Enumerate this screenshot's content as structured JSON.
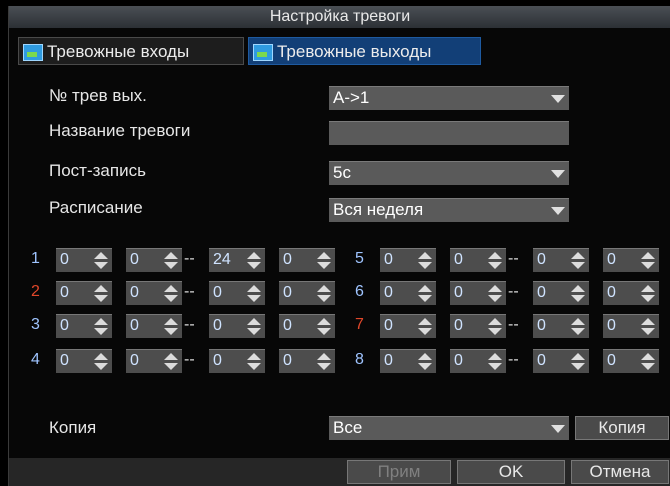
{
  "title": "Настройка тревоги",
  "tabs": [
    {
      "label": "Тревожные входы",
      "active": false
    },
    {
      "label": "Тревожные выходы",
      "active": true
    }
  ],
  "fields": {
    "alarm_out_no": {
      "label": "№ трев вых.",
      "value": "A->1"
    },
    "alarm_name": {
      "label": "Название тревоги",
      "value": ""
    },
    "post_record": {
      "label": "Пост-запись",
      "value": "5с"
    },
    "schedule": {
      "label": "Расписание",
      "value": "Вся неделя"
    }
  },
  "schedule_rows": [
    {
      "num": "1",
      "v": [
        "0",
        "0",
        "24",
        "0"
      ]
    },
    {
      "num": "2",
      "v": [
        "0",
        "0",
        "0",
        "0"
      ]
    },
    {
      "num": "3",
      "v": [
        "0",
        "0",
        "0",
        "0"
      ]
    },
    {
      "num": "4",
      "v": [
        "0",
        "0",
        "0",
        "0"
      ]
    },
    {
      "num": "5",
      "v": [
        "0",
        "0",
        "0",
        "0"
      ]
    },
    {
      "num": "6",
      "v": [
        "0",
        "0",
        "0",
        "0"
      ]
    },
    {
      "num": "7",
      "v": [
        "0",
        "0",
        "0",
        "0"
      ]
    },
    {
      "num": "8",
      "v": [
        "0",
        "0",
        "0",
        "0"
      ]
    }
  ],
  "copy": {
    "label": "Копия",
    "value": "Все",
    "button": "Копия"
  },
  "buttons": {
    "apply": "Прим",
    "ok": "OK",
    "cancel": "Отмена"
  },
  "colors": {
    "accent": "#123f77",
    "number_red": "#e0472a",
    "number_blue": "#9fc4ff"
  }
}
